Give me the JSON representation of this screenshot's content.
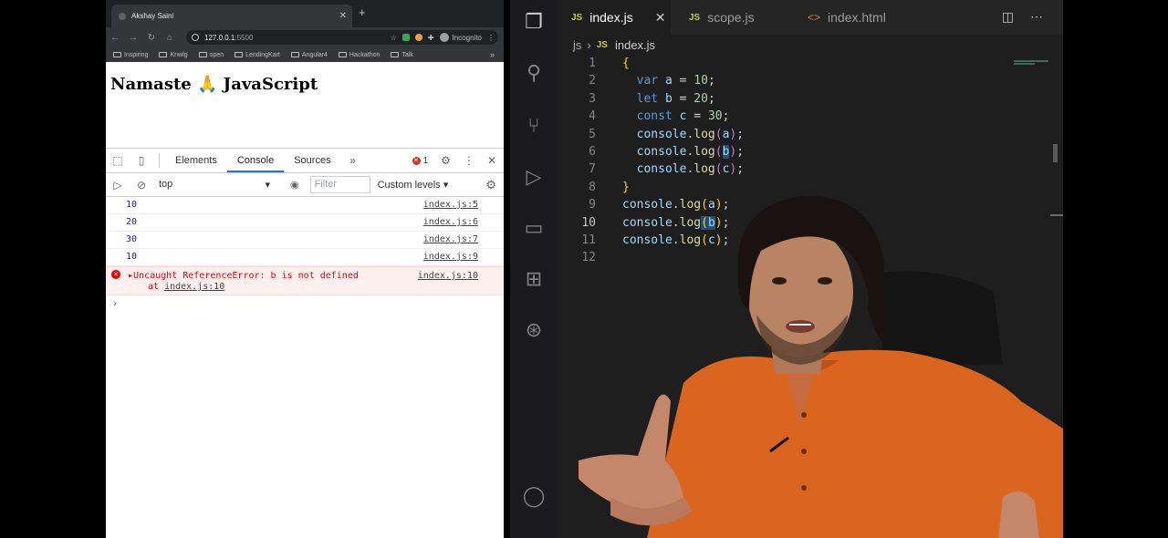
{
  "browser": {
    "tab_title": "Akshay Saini",
    "url_host": "127.0.0.1",
    "url_port": ":5500",
    "incognito_label": "Incognito",
    "bookmarks": [
      "Inspiring",
      "Knwlg",
      "open",
      "LendingKart",
      "Angular4",
      "Hackathon",
      "Talk"
    ],
    "page_heading": "Namaste 🙏 JavaScript"
  },
  "devtools": {
    "tabs": [
      "Elements",
      "Console",
      "Sources"
    ],
    "active_tab": "Console",
    "error_count": "1",
    "context": "top",
    "filter_placeholder": "Filter",
    "levels": "Custom levels ▾",
    "logs": [
      {
        "value": "10",
        "source": "index.js:5"
      },
      {
        "value": "20",
        "source": "index.js:6"
      },
      {
        "value": "30",
        "source": "index.js:7"
      },
      {
        "value": "10",
        "source": "index.js:9"
      }
    ],
    "error": {
      "message": "Uncaught ReferenceError: b is not defined",
      "at_prefix": "at ",
      "at_link": "index.js:10",
      "source": "index.js:10"
    },
    "prompt": "›"
  },
  "vscode": {
    "tabs": [
      {
        "label": "index.js",
        "badge": "JS"
      },
      {
        "label": "scope.js",
        "badge": "JS"
      },
      {
        "label": "index.html",
        "badge": "<>"
      }
    ],
    "breadcrumb": {
      "folder": "js",
      "file": "index.js",
      "badge": "JS"
    },
    "line_numbers": [
      "1",
      "2",
      "3",
      "4",
      "5",
      "6",
      "7",
      "8",
      "9",
      "10",
      "11",
      "12"
    ]
  },
  "colors": {
    "editor_bg": "#1e1e1e",
    "keyword": "#569cd6",
    "variable": "#9cdcfe",
    "number": "#b5cea8",
    "function": "#dcdcaa",
    "error_text": "#ee0000"
  }
}
